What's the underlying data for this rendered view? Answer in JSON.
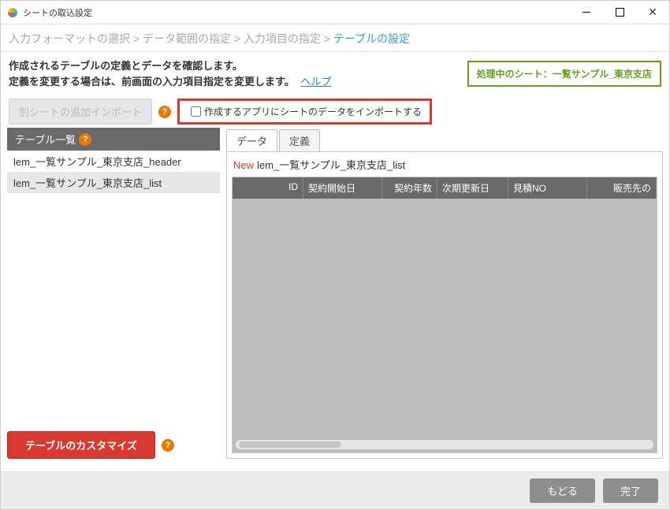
{
  "window": {
    "title": "シートの取込設定"
  },
  "breadcrumb": {
    "step1": "入力フォーマットの選択",
    "step2": "データ範囲の指定",
    "step3": "入力項目の指定",
    "step4": "テーブルの設定",
    "sep": ">"
  },
  "description": {
    "line1": "作成されるテーブルの定義とデータを確認します。",
    "line2": "定義を変更する場合は、前画面の入力項目指定を変更します。",
    "help": "ヘルプ"
  },
  "processing_sheet": {
    "label": "処理中のシート：",
    "value": "一覧サンプル_東京支店"
  },
  "import": {
    "additional_button": "別シートの追加インポート",
    "checkbox_label": "作成するアプリにシートのデータをインポートする"
  },
  "table_list": {
    "header": "テーブル一覧",
    "items": [
      "lem_一覧サンプル_東京支店_header",
      "lem_一覧サンプル_東京支店_list"
    ],
    "selected_index": 1
  },
  "tabs": {
    "data": "データ",
    "definition": "定義",
    "active": "data"
  },
  "detail": {
    "new_tag": "New",
    "name": "lem_一覧サンプル_東京支店_list",
    "columns": {
      "id": "ID",
      "c1": "契約開始日",
      "c2": "契約年数",
      "c3": "次期更新日",
      "c4": "見積NO",
      "c5": "販売先の"
    }
  },
  "buttons": {
    "customize": "テーブルのカスタマイズ",
    "back": "もどる",
    "finish": "完了"
  }
}
